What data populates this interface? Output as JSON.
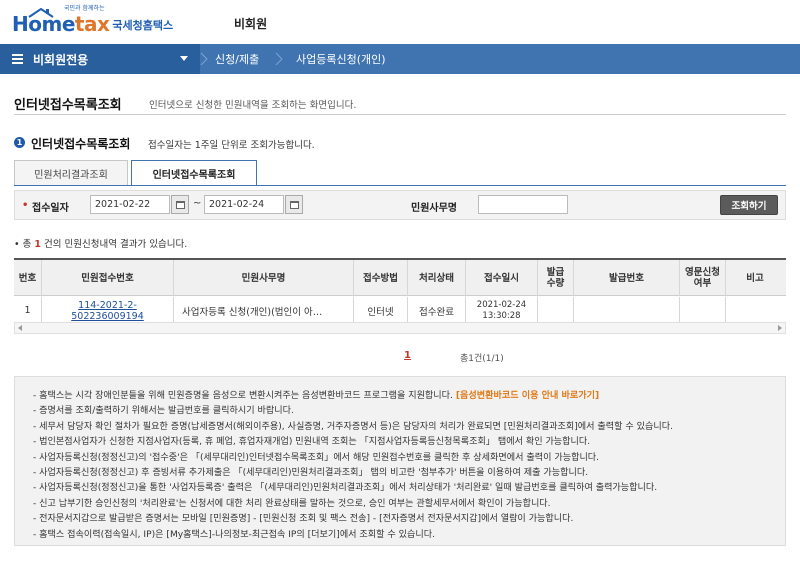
{
  "header": {
    "logo_text_home": "Home",
    "logo_text_tax": "tax",
    "logo_sub": "국세청홈택스",
    "logo_tagline": "국민과 함께하는",
    "guest_label": "비회원"
  },
  "nav": {
    "menu_label": "비회원전용",
    "crumbs": [
      "신청/제출",
      "사업등록신청(개인)"
    ]
  },
  "page": {
    "title": "인터넷접수목록조회",
    "description": "인터넷으로 신청한 민원내역을 조회하는 화면입니다."
  },
  "section": {
    "bullet": "1",
    "title": "인터넷접수목록조회",
    "description": "접수일자는 1주일 단위로 조회가능합니다."
  },
  "tabs": [
    {
      "label": "민원처리결과조회",
      "active": false
    },
    {
      "label": "인터넷접수목록조회",
      "active": true
    }
  ],
  "search": {
    "req_mark": "•",
    "date_label": "접수일자",
    "date_from": "2021-02-22",
    "date_sep": "~",
    "date_to": "2021-02-24",
    "office_label": "민원사무명",
    "office_value": "",
    "query_button": "조회하기"
  },
  "result": {
    "prefix": "• 총 ",
    "count": "1",
    "suffix": " 건의 민원신청내역 결과가 있습니다."
  },
  "table": {
    "headers": [
      "번호",
      "민원접수번호",
      "민원사무명",
      "접수방법",
      "처리상태",
      "접수일시",
      "발급\n수량",
      "발급번호",
      "영문신청\n여부",
      "비고"
    ],
    "rows": [
      {
        "no": "1",
        "receipt_no": "114-2021-2-502236009194",
        "office_name": "사업자등록 신청(개인)(법인이 아…",
        "method": "인터넷",
        "status": "접수완료",
        "datetime_date": "2021-02-24",
        "datetime_time": "13:30:28",
        "issue_qty": "",
        "issue_no": "",
        "english": "",
        "remark": ""
      }
    ]
  },
  "pager": {
    "current": "1",
    "total": "총1건(1/1)"
  },
  "notice": {
    "items": [
      {
        "text": "- 홈택스는 시각 장애인분들을 위해 민원증명을 음성으로 변환시켜주는 음성변환바코드 프로그램을 지원합니다.",
        "link": "[음성변환바코드 이용 안내 바로가기]"
      },
      {
        "text": "- 증명서를 조회/출력하기 위해서는 발급번호를 클릭하시기 바랍니다."
      },
      {
        "text": "- 세무서 담당자 확인 절차가 필요한 증명(납세증명서(해외이주용), 사실증명, 거주자증명서 등)은 담당자의 처리가 완료되면 [민원처리결과조회]에서 출력할 수 있습니다."
      },
      {
        "text": "- 법인본점사업자가 신청한 지점사업자(등록, 휴 폐업, 휴업자재개업) 민원내역 조회는 「지점사업자등록등신청목록조회」 탭에서 확인 가능합니다."
      },
      {
        "text": "- 사업자등록신청(정정신고)의 '접수중'은 「(세무대리인)인터넷접수목록조회」에서 해당 민원접수번호를 클릭한 후 상세화면에서 출력이 가능합니다."
      },
      {
        "text": "- 사업자등록신청(정정신고) 후 증빙서류 추가제출은 「(세무대리인)민원처리결과조회」 탭의 비고란 '첨부추가' 버튼을 이용하여 제출 가능합니다."
      },
      {
        "text": "- 사업자등록신청(정정신고)을 통한 '사업자등록증' 출력은 「(세무대리인)민원처리결과조회」에서 처리상태가 '처리완료' 일때 발급번호를 클릭하여 출력가능합니다."
      },
      {
        "text": "- 신고 납부기한 승인신청의 '처리완료'는 신청서에 대한 처리 완료상태를 말하는 것으로, 승인 여부는 관할세무서에서 확인이 가능합니다."
      },
      {
        "text": "- 전자문서지갑으로 발급받은 증명서는 모바일 [민원증명] - [민원신청 조회 및 팩스 전송] - [전자증명서 전자문서지갑]에서 열람이 가능합니다."
      },
      {
        "text": "- 홈택스 접속이력(접속일시, IP)은 [My홈택스]-나의정보-최근접속 IP의 [더보기]에서 조회할 수 있습니다."
      }
    ]
  },
  "colors": {
    "nav_bg": "#3f74b1",
    "nav_menu_bg": "#2a5f9e",
    "accent_red": "#c0392b",
    "highlight_orange": "#e07b19",
    "link_blue": "#1e4f9c"
  }
}
